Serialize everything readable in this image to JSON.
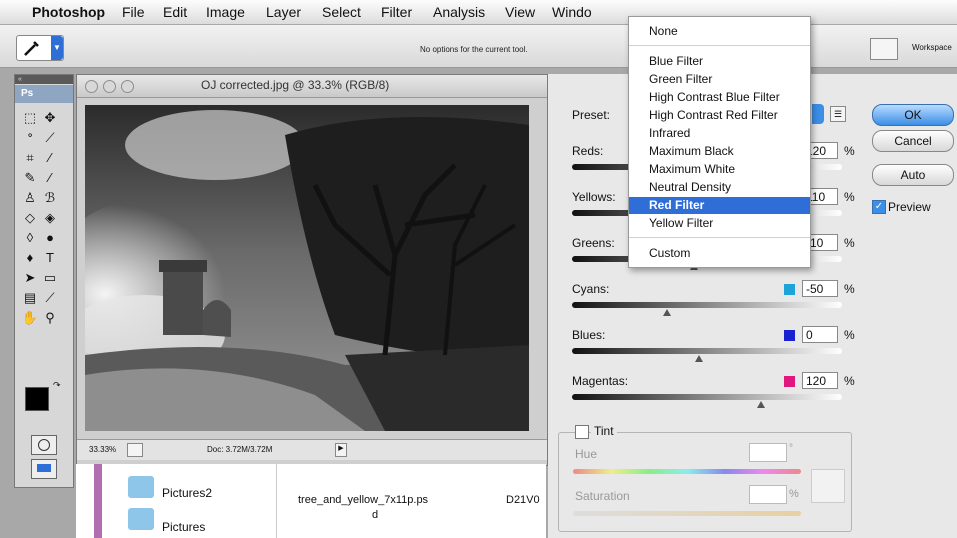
{
  "menubar": {
    "items": [
      "Photoshop",
      "File",
      "Edit",
      "Image",
      "Layer",
      "Select",
      "Filter",
      "Analysis",
      "View",
      "Windo"
    ]
  },
  "options_bar": {
    "message": "No options for the current tool.",
    "workspace_label": "Workspace"
  },
  "toolbox": {
    "title": "Ps"
  },
  "document": {
    "title": "OJ corrected.jpg @ 33.3% (RGB/8)",
    "zoom": "33.33%",
    "doc_size": "Doc: 3.72M/3.72M"
  },
  "finder": {
    "items": [
      "Pictures2",
      "Pictures"
    ],
    "file_name": "tree_and_yellow_7x11p.ps",
    "file_name_tail": "d",
    "col_text": "D21V0"
  },
  "dialog": {
    "preset_label": "Preset:",
    "sliders": [
      {
        "label": "Reds:",
        "value": "120",
        "color": "#d8232a",
        "thumb": 0.7
      },
      {
        "label": "Yellows:",
        "value": "110",
        "color": "#f2d21b",
        "thumb": 0.67
      },
      {
        "label": "Greens:",
        "value": "-10",
        "color": "#2aa748",
        "thumb": 0.45
      },
      {
        "label": "Cyans:",
        "value": "-50",
        "color": "#1ea3d8",
        "thumb": 0.35
      },
      {
        "label": "Blues:",
        "value": "0",
        "color": "#1a22d0",
        "thumb": 0.47
      },
      {
        "label": "Magentas:",
        "value": "120",
        "color": "#e0177c",
        "thumb": 0.7
      }
    ],
    "percent": "%",
    "buttons": {
      "ok": "OK",
      "cancel": "Cancel",
      "auto": "Auto"
    },
    "preview_label": "Preview",
    "tint_label": "Tint",
    "hue_label": "Hue",
    "saturation_label": "Saturation",
    "degree": "°",
    "sat_pct": "%"
  },
  "preset_menu": {
    "items": [
      "None",
      "Blue Filter",
      "Green Filter",
      "High Contrast Blue Filter",
      "High Contrast Red Filter",
      "Infrared",
      "Maximum Black",
      "Maximum White",
      "Neutral Density",
      "Red Filter",
      "Yellow Filter",
      "Custom"
    ],
    "selected": "Red Filter"
  }
}
